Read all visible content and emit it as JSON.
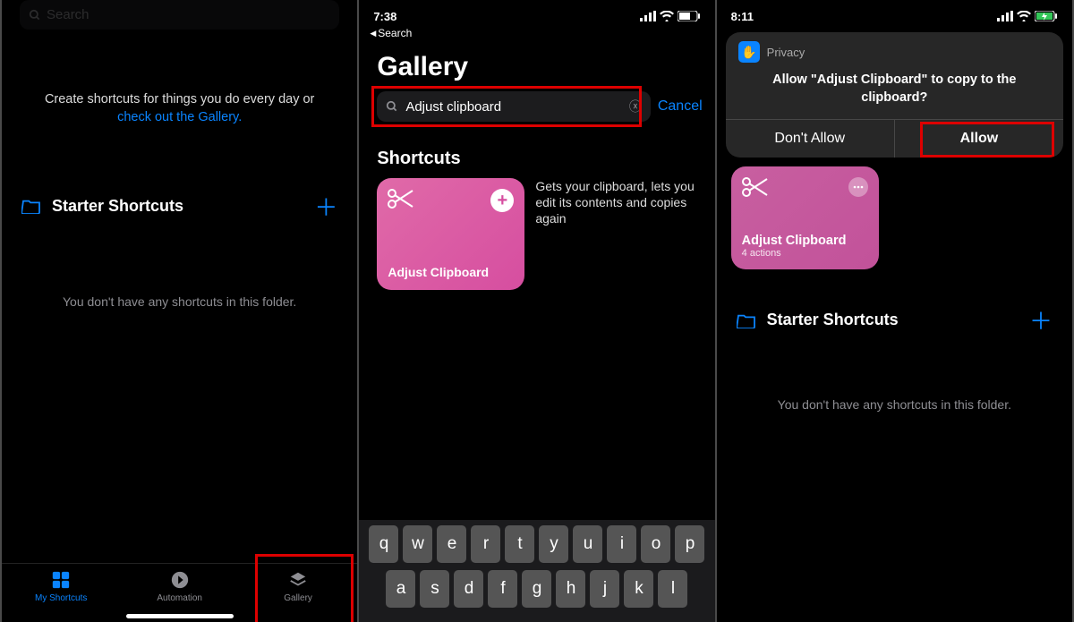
{
  "phone1": {
    "intro_line1": "Create shortcuts for things you do every day or",
    "intro_link": "check out the Gallery",
    "folder_name": "Starter Shortcuts",
    "empty_msg": "You don't have any shortcuts in this folder.",
    "tabs": {
      "shortcuts": "My Shortcuts",
      "automation": "Automation",
      "gallery": "Gallery"
    },
    "search_placeholder": "Search"
  },
  "phone2": {
    "time": "7:38",
    "back": "Search",
    "title": "Gallery",
    "search_value": "Adjust clipboard",
    "cancel": "Cancel",
    "section": "Shortcuts",
    "card_title": "Adjust Clipboard",
    "result_desc": "Gets your clipboard, lets you edit its contents and copies again",
    "krow1": [
      "q",
      "w",
      "e",
      "r",
      "t",
      "y",
      "u",
      "i",
      "o",
      "p"
    ],
    "krow2": [
      "a",
      "s",
      "d",
      "f",
      "g",
      "h",
      "j",
      "k",
      "l"
    ]
  },
  "phone3": {
    "time": "8:11",
    "privacy": "Privacy",
    "modal_msg": "Allow \"Adjust Clipboard\" to copy to the clipboard?",
    "dont_allow": "Don't Allow",
    "allow": "Allow",
    "card_title": "Adjust Clipboard",
    "card_sub": "4 actions",
    "folder_name": "Starter Shortcuts",
    "empty_msg": "You don't have any shortcuts in this folder."
  }
}
